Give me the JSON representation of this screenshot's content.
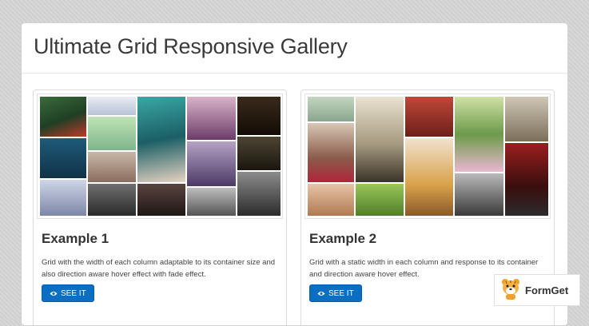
{
  "page": {
    "title": "Ultimate Grid Responsive Gallery"
  },
  "examples": [
    {
      "title": "Example 1",
      "description": "Grid with the width of each column adaptable to its container size and also direction aware hover effect with fade effect.",
      "button_label": "SEE IT",
      "button_icon": "eye-icon"
    },
    {
      "title": "Example 2",
      "description": "Grid with a static width in each column and response to its container and direction aware hover effect.",
      "button_label": "SEE IT",
      "button_icon": "eye-icon"
    }
  ],
  "brand": {
    "name": "FormGet",
    "logo_icon": "tiger-mascot-icon"
  },
  "colors": {
    "accent": "#0a6fc2",
    "background": "#d6d6d6",
    "panel": "#ffffff"
  }
}
